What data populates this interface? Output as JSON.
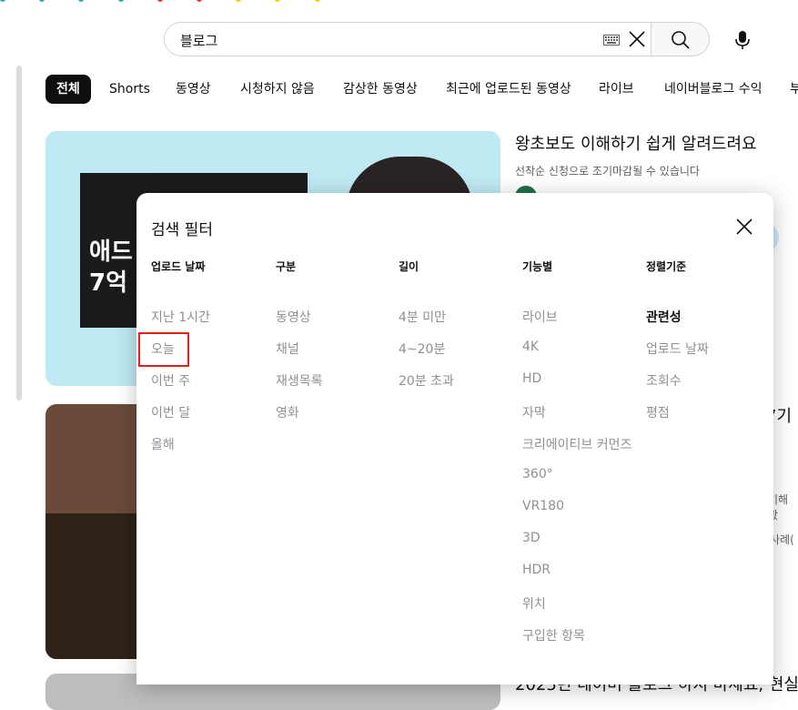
{
  "search": {
    "query": "블로그"
  },
  "chips": [
    "전체",
    "Shorts",
    "동영상",
    "시청하지 않음",
    "감상한 동영상",
    "최근에 업로드된 동영상",
    "라이브",
    "네이버블로그 수익",
    "부"
  ],
  "videos": [
    {
      "title": "왕초보도 이해하기 쉽게 알려드려요",
      "description": "선착순 신청으로 조기마감될 수 있습니다",
      "thumb_text": [
        "애드",
        "7억"
      ]
    },
    {
      "title_fragment": "7기",
      "desc_fragment": "기해봤",
      "desc_fragment2": "사례("
    },
    {
      "title_fragment": "2025년 네이버 블로그 하지 마세요, 현실"
    }
  ],
  "filter_dialog": {
    "title": "검색 필터",
    "columns": [
      {
        "header": "업로드 날짜",
        "options": [
          "지난 1시간",
          "오늘",
          "이번 주",
          "이번 달",
          "올해"
        ]
      },
      {
        "header": "구분",
        "options": [
          "동영상",
          "채널",
          "재생목록",
          "영화"
        ]
      },
      {
        "header": "길이",
        "options": [
          "4분 미만",
          "4~20분",
          "20분 초과"
        ]
      },
      {
        "header": "기능별",
        "options": [
          "라이브",
          "4K",
          "HD",
          "자막",
          "크리에이티브 커먼즈",
          "360°",
          "VR180",
          "3D",
          "HDR",
          "위치",
          "구입한 항목"
        ]
      },
      {
        "header": "정렬기준",
        "options": [
          "관련성",
          "업로드 날짜",
          "조회수",
          "평점"
        ],
        "selected": "관련성"
      }
    ]
  },
  "icons": [
    "keyboard-icon",
    "clear-icon",
    "search-icon",
    "mic-icon",
    "close-icon"
  ]
}
